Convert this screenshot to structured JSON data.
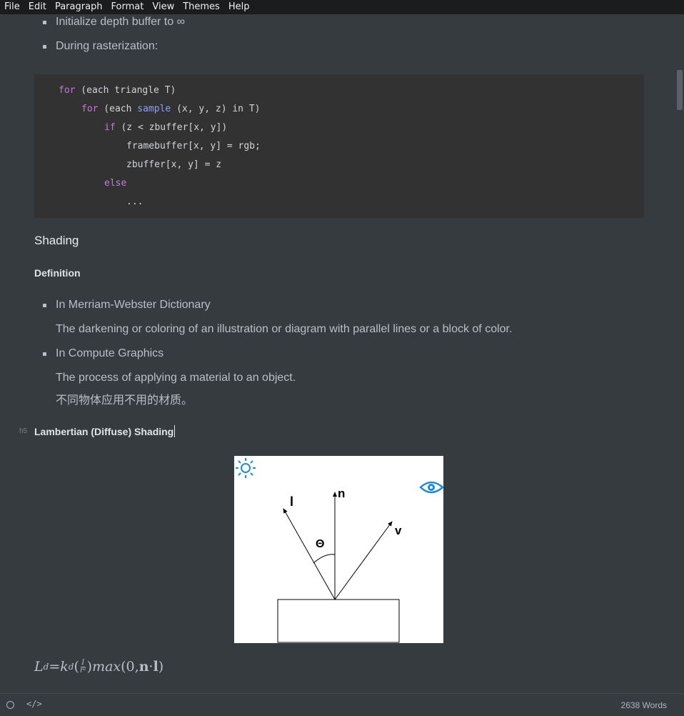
{
  "menu": [
    "File",
    "Edit",
    "Paragraph",
    "Format",
    "View",
    "Themes",
    "Help"
  ],
  "list1": {
    "item1": "Initialize depth buffer to ∞",
    "item2": "During rasterization:"
  },
  "code": {
    "l1_kw": "for",
    "l1_rest": " (each triangle T)",
    "l2_kw": "for",
    "l2_a": " (each ",
    "l2_fn": "sample",
    "l2_b": " (x, y, z) in T)",
    "l3_kw": "if",
    "l3_rest": " (z < zbuffer[x, y])",
    "l4": "framebuffer[x, y] = rgb;",
    "l5": "zbuffer[x, y] = z",
    "l6_kw": "else",
    "l7": "..."
  },
  "shading_heading": "Shading",
  "definition_heading": "Definition",
  "definitions": {
    "item1": "In Merriam-Webster Dictionary",
    "item1_desc": "The darkening or coloring of an illustration or diagram with parallel lines or a block of color.",
    "item2": "In Compute Graphics",
    "item2_desc1": "The process of applying a material to an object.",
    "item2_desc2": "不同物体应用不用的材质。"
  },
  "gutter_mark": "h5",
  "lambertian_heading": "Lambertian (Diffuse) Shading",
  "figure": {
    "label_l": "l",
    "label_n": "n",
    "label_v": "v",
    "label_theta": "Θ",
    "light_icon": "sun-icon",
    "viewer_icon": "eye-icon",
    "accent": "#1e88e5"
  },
  "formula": {
    "L": "L",
    "d_sub": "d",
    "eq": " = ",
    "k": "k",
    "kd_sub": "d",
    "open": "(",
    "num": "I",
    "den": "r²",
    "close": ")",
    "max": "max",
    "args_a": "(0, ",
    "n": "n",
    "dot": " · ",
    "l": "l",
    "args_b": ")"
  },
  "status": {
    "code_toggle": "</>",
    "word_count": "2638 Words"
  }
}
